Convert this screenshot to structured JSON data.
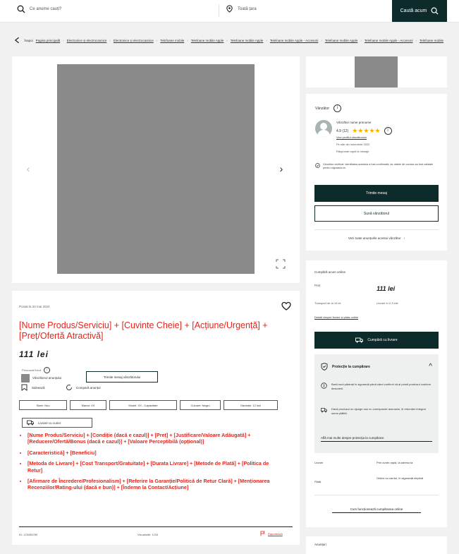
{
  "header": {
    "search_placeholder": "Ce anume cauți?",
    "location_placeholder": "Toată țara",
    "search_button": "Caută acum"
  },
  "breadcrumb": {
    "back_label": "Înapoi",
    "items": [
      "Pagina principală",
      "Electronice și electrocasnice",
      "Electronice și electrocasnice",
      "Telefoane mobile",
      "Telefoane mobile Apple",
      "Telefoane mobile Apple",
      "Telefoane mobile Apple - Accesorii",
      "Telefoane mobile Apple",
      "Telefoane mobile Apple - Accesorii",
      "Telefoane mobile"
    ]
  },
  "gallery": {
    "prev": "‹",
    "next": "›"
  },
  "product": {
    "category_line": "Postat la 20 mai 2024",
    "title": "[Nume Produs/Serviciu] + [Cuvinte Cheie] + [Acțiune/Urgență] + [Preț/Ofertă Atractivă]",
    "price": "111 lei",
    "seller_label": "Persoană fizică",
    "seller_name": "Vânzătorul anunțului",
    "contact_button": "Trimite mesaj vânzătorului",
    "save_label": "Salvează",
    "compare_label": "Compară anunțul",
    "chips": [
      "Stare: Nou",
      "Marca: XX",
      "Model: XX - Capacitate",
      "Culoare: Negru",
      "Garanție: 12 luni"
    ],
    "delivery_chip": "Livrare cu curier",
    "bullets": [
      "[Nume Produs/Serviciu] + [Condiție (dacă e cazul)] + [Preț] + [Justificare/Valoare Adăugată] + [Reducere/Ofertă/Bonus (dacă e cazul)] + [Valoare Perceptibilă (opțional)]",
      "[Caracteristică] + [Beneficiu]",
      "[Metoda de Livrare] + [Cost Transport/Gratuitate] + [Durata Livrare] + [Metode de Plată] + [Politica de Retur]",
      "[Afirmare de Încredere/Profesionalism] + [Referire la Garanție/Politică de Retur Clară] + [Menționarea Recenziilor/Rating-ului (dacă e bun)] + [Îndemn la Contact/Acțiune]"
    ],
    "footer_id": "ID: 123456789",
    "footer_views": "Vizualizări: 1234",
    "report_label": "Raportează"
  },
  "seller": {
    "heading": "Vânzător",
    "name": "Vânzător nume prenume",
    "rating_text": "4.9 (12)",
    "stars": "★★★★★",
    "profile_link": "Vezi profilul vânzătorului",
    "member_since": "Pe site din noiembrie 2020",
    "replies": "Răspunde rapid la mesaje",
    "verified": "Vânzător verificat: identitatea acestuia a fost confirmată, iar datele de contact au fost validate pentru siguranța ta.",
    "message_button": "Trimite mesaj",
    "phone_button": "Sună vânzătorul",
    "all_ads_link": "Vezi toate anunțurile acestui vânzător"
  },
  "purchase": {
    "title": "Cumpără acum online",
    "price_label": "Preț",
    "price": "111 lei",
    "sub1": "Transport de la 15 lei",
    "sub2": "Livrare în 2-3 zile",
    "link": "Detalii despre livrare și plata online",
    "delivery_button": "Cumpără cu livrare",
    "protection_title": "Protecție la cumpărare",
    "protection_items": [
      "Banii sunt păstrați în siguranță până când confirmi că ai primit produsul conform descrierii.",
      "Dacă produsul nu ajunge sau nu corespunde anunțului, îți returnăm integral suma plătită."
    ],
    "protection_link": "Află mai multe despre protecția la cumpărare",
    "kv": [
      {
        "k": "Livrare",
        "v": "Prin curier rapid, la adresa ta"
      },
      {
        "k": "Plată",
        "v": "Online cu cardul, în siguranță deplină"
      }
    ],
    "bottom_link": "Cum funcționează cumpărarea online"
  },
  "similar": {
    "title": "Anunțuri"
  }
}
